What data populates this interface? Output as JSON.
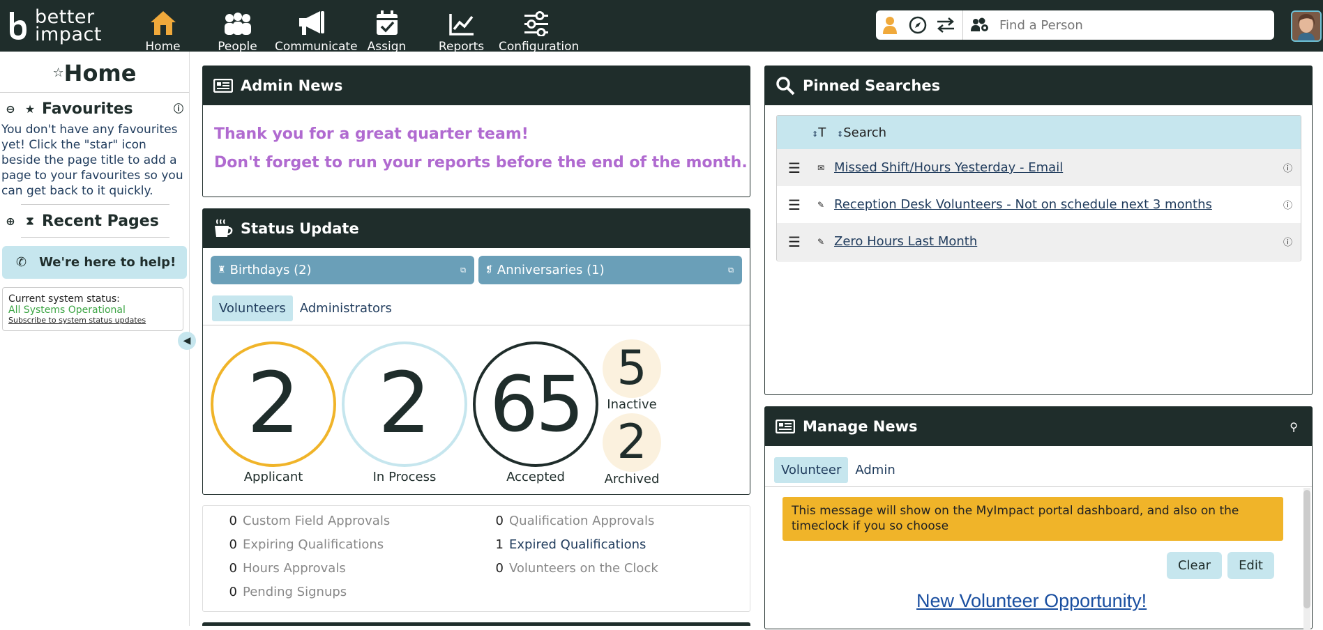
{
  "brand": {
    "line1": "better",
    "line2": "impact"
  },
  "nav": [
    {
      "label": "Home",
      "icon": "home-icon"
    },
    {
      "label": "People",
      "icon": "people-icon"
    },
    {
      "label": "Communicate",
      "icon": "megaphone-icon"
    },
    {
      "label": "Assign",
      "icon": "calendar-check-icon"
    },
    {
      "label": "Reports",
      "icon": "chart-line-icon"
    },
    {
      "label": "Configuration",
      "icon": "sliders-icon"
    }
  ],
  "search": {
    "placeholder": "Find a Person"
  },
  "sidebar": {
    "title": "Home",
    "favourites": {
      "heading": "Favourites",
      "text": "You don't have any favourites yet! Click the \"star\" icon beside the page title to add a page to your favourites so you can get back to it quickly."
    },
    "recent": {
      "heading": "Recent Pages"
    },
    "help": "We're here to help!",
    "status": {
      "label": "Current system status:",
      "value": "All Systems Operational",
      "subscribe": "Subscribe to system status updates"
    }
  },
  "admin_news": {
    "title": "Admin News",
    "lines": [
      "Thank you for a great quarter team!",
      "Don't forget to run your reports before the end of the month."
    ]
  },
  "status_update": {
    "title": "Status Update",
    "birthdays": "Birthdays (2)",
    "anniversaries": "Anniversaries (1)",
    "tabs": [
      "Volunteers",
      "Administrators"
    ],
    "stats": {
      "applicant": {
        "value": "2",
        "label": "Applicant",
        "color": "#f0b429"
      },
      "in_process": {
        "value": "2",
        "label": "In Process",
        "color": "#c6e6ee"
      },
      "accepted": {
        "value": "65",
        "label": "Accepted",
        "color": "#1f2d2b"
      },
      "inactive": {
        "value": "5",
        "label": "Inactive"
      },
      "archived": {
        "value": "2",
        "label": "Archived"
      }
    }
  },
  "counts": [
    {
      "n": "0",
      "label": "Custom Field Approvals"
    },
    {
      "n": "0",
      "label": "Qualification Approvals"
    },
    {
      "n": "0",
      "label": "Expiring Qualifications"
    },
    {
      "n": "1",
      "label": "Expired Qualifications"
    },
    {
      "n": "0",
      "label": "Hours Approvals"
    },
    {
      "n": "0",
      "label": "Volunteers on the Clock"
    },
    {
      "n": "0",
      "label": "Pending Signups"
    }
  ],
  "pinned": {
    "title": "Pinned Searches",
    "col_type": "T",
    "col_search": "Search",
    "rows": [
      {
        "type_icon": "envelope-icon",
        "label": "Missed Shift/Hours Yesterday - Email"
      },
      {
        "type_icon": "pencil-icon",
        "label": "Reception Desk Volunteers - Not on schedule next 3 months"
      },
      {
        "type_icon": "pencil-icon",
        "label": "Zero Hours Last Month"
      }
    ]
  },
  "manage_news": {
    "title": "Manage News",
    "tabs": [
      "Volunteer",
      "Admin"
    ],
    "message": "This message will show on the MyImpact portal dashboard, and also on the timeclock if you so choose",
    "clear": "Clear",
    "edit": "Edit",
    "headline": "New Volunteer Opportunity!"
  },
  "colors": {
    "dark": "#1f2d2b",
    "accent": "#c6e6ee",
    "gold": "#f0b429",
    "purple": "#b06ad0"
  }
}
